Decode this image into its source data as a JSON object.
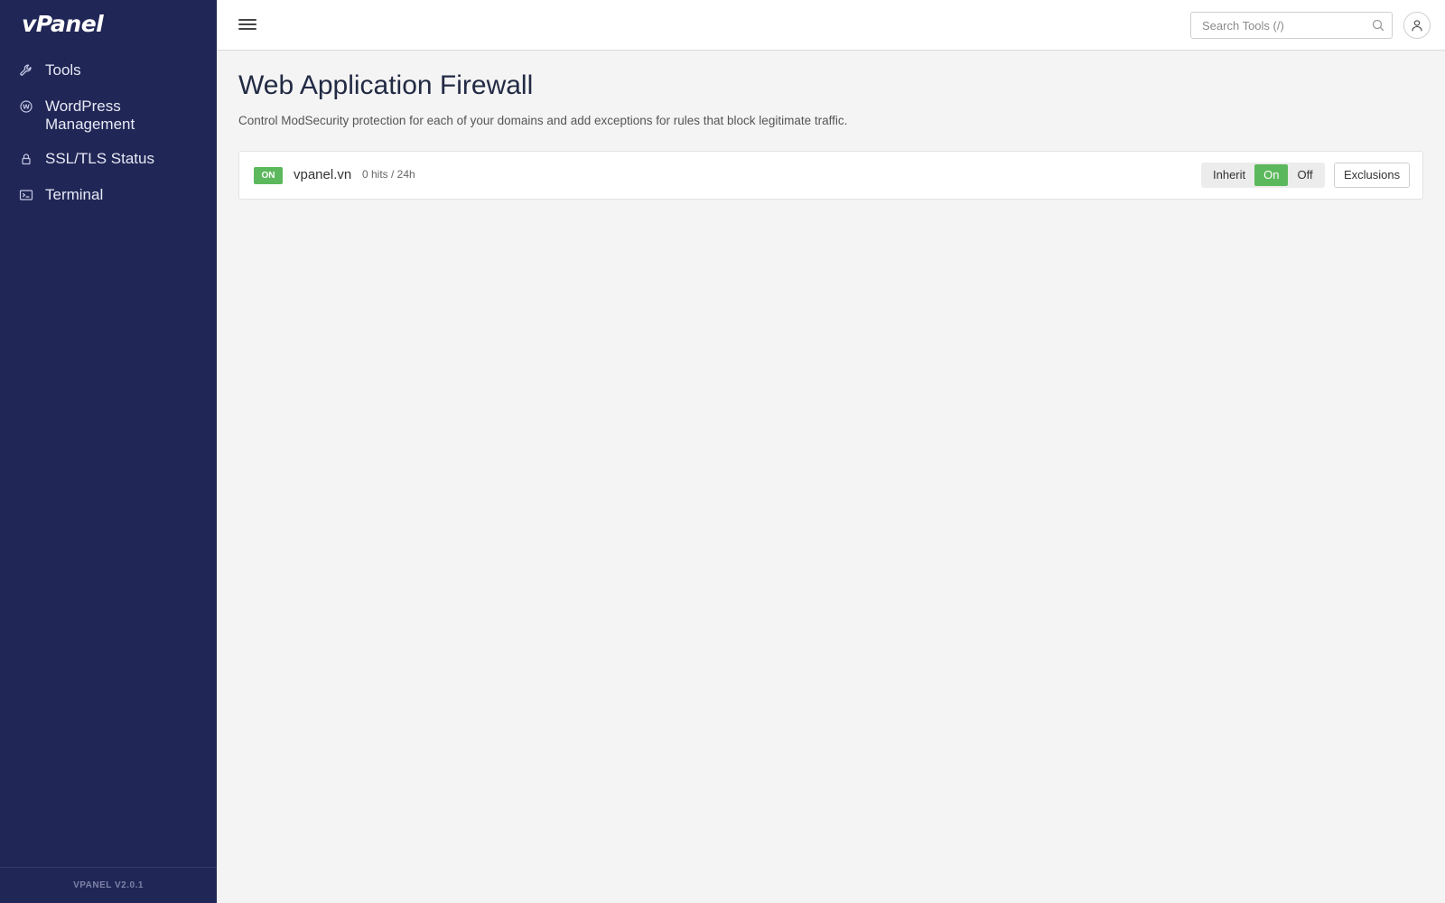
{
  "brand": {
    "logo": "vPanel",
    "version": "VPANEL V2.0.1"
  },
  "sidebar": {
    "items": [
      {
        "label": "Tools",
        "icon": "wrench-icon"
      },
      {
        "label": "WordPress Management",
        "icon": "wordpress-icon"
      },
      {
        "label": "SSL/TLS Status",
        "icon": "lock-icon"
      },
      {
        "label": "Terminal",
        "icon": "terminal-icon"
      }
    ]
  },
  "topbar": {
    "search_placeholder": "Search Tools (/)",
    "menu_icon": "hamburger-menu-icon",
    "search_icon": "search-icon",
    "user_icon": "user-icon"
  },
  "main": {
    "title": "Web Application Firewall",
    "description": "Control ModSecurity protection for each of your domains and add exceptions for rules that block legitimate traffic.",
    "domains": [
      {
        "status_badge": "ON",
        "name": "vpanel.vn",
        "hits": "0 hits / 24h",
        "mode_options": [
          "Inherit",
          "On",
          "Off"
        ],
        "selected_mode": "On",
        "exclusions_label": "Exclusions"
      }
    ]
  },
  "colors": {
    "sidebar_bg": "#202655",
    "accent_green": "#5cb85c",
    "page_bg": "#f4f4f4"
  }
}
